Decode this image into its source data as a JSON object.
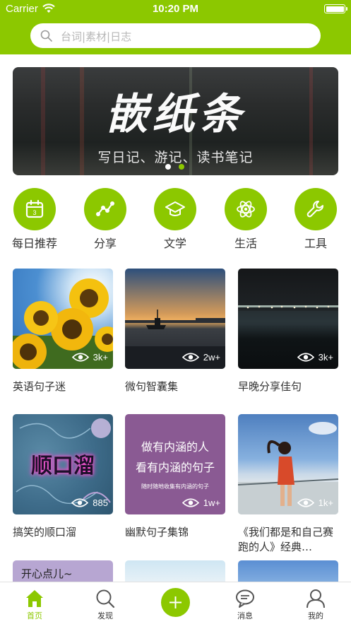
{
  "status_bar": {
    "carrier": "Carrier",
    "time": "10:20 PM",
    "wifi_icon": "wifi-icon",
    "battery_icon": "battery-icon"
  },
  "search": {
    "placeholder": "台词|素材|日志",
    "icon": "search-icon"
  },
  "banner": {
    "title": "嵌纸条",
    "subtitle": "写日记、游记、读书笔记",
    "page_count": 2,
    "active_page": 2
  },
  "categories": [
    {
      "label": "每日推荐",
      "icon": "calendar-icon"
    },
    {
      "label": "分享",
      "icon": "share-graph-icon"
    },
    {
      "label": "文学",
      "icon": "graduation-cap-icon"
    },
    {
      "label": "生活",
      "icon": "atom-icon"
    },
    {
      "label": "工具",
      "icon": "wrench-icon"
    }
  ],
  "cards": [
    {
      "title": "英语句子迷",
      "views": "3k+"
    },
    {
      "title": "微句智囊集",
      "views": "2w+"
    },
    {
      "title": "早晚分享佳句",
      "views": "3k+"
    },
    {
      "title": "搞笑的顺口溜",
      "views": "885",
      "cover_text": "顺口溜"
    },
    {
      "title": "幽默句子集锦",
      "views": "1w+",
      "cover_lines": [
        "做有内涵的人",
        "看有内涵的句子",
        "随时随地收集有内涵的句子"
      ]
    },
    {
      "title": "《我们都是和自己赛跑的人》经典…",
      "views": "1k+"
    },
    {
      "title": "",
      "views": "",
      "cover_text": "开心点儿~"
    },
    {
      "title": "",
      "views": ""
    },
    {
      "title": "",
      "views": ""
    }
  ],
  "tabs": [
    {
      "label": "首页",
      "icon": "home-icon",
      "active": true
    },
    {
      "label": "发现",
      "icon": "search-icon",
      "active": false
    },
    {
      "label": "",
      "icon": "plus-icon",
      "active": false
    },
    {
      "label": "消息",
      "icon": "chat-bubble-icon",
      "active": false
    },
    {
      "label": "我的",
      "icon": "user-icon",
      "active": false
    }
  ],
  "colors": {
    "accent": "#8cc800",
    "text": "#333333",
    "placeholder": "#b7b7b7"
  }
}
